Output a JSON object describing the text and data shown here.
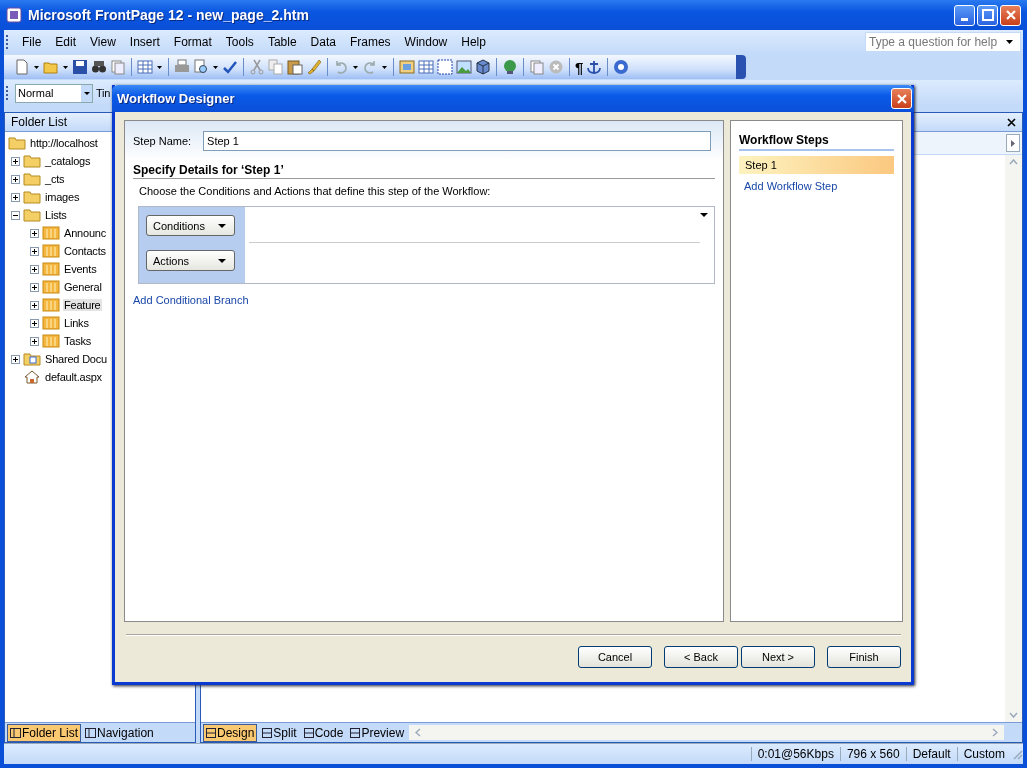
{
  "window": {
    "title": "Microsoft FrontPage 12  - new_page_2.htm"
  },
  "menu": [
    "File",
    "Edit",
    "View",
    "Insert",
    "Format",
    "Tools",
    "Table",
    "Data",
    "Frames",
    "Window",
    "Help"
  ],
  "help_box": {
    "placeholder": "Type a question for help"
  },
  "toolbar": {
    "pilcrow": "¶"
  },
  "format_bar": {
    "style": "Normal",
    "font": "Tin"
  },
  "folder_list": {
    "title": "Folder List",
    "tree": [
      {
        "label": "http://localhost",
        "kind": "site",
        "selected": false,
        "children": [
          {
            "label": "_catalogs",
            "kind": "folder",
            "expanded": false,
            "selected": false
          },
          {
            "label": "_cts",
            "kind": "folder",
            "expanded": false,
            "selected": false
          },
          {
            "label": "images",
            "kind": "folder",
            "expanded": false,
            "selected": false
          },
          {
            "label": "Lists",
            "kind": "folder",
            "expanded": true,
            "selected": false,
            "children": [
              {
                "label": "Announc",
                "kind": "list",
                "expanded": false,
                "selected": false
              },
              {
                "label": "Contacts",
                "kind": "list",
                "expanded": false,
                "selected": false
              },
              {
                "label": "Events",
                "kind": "list",
                "expanded": false,
                "selected": false
              },
              {
                "label": "General",
                "kind": "list",
                "expanded": false,
                "selected": false
              },
              {
                "label": "Feature",
                "kind": "list",
                "expanded": false,
                "selected": true
              },
              {
                "label": "Links",
                "kind": "list",
                "expanded": false,
                "selected": false
              },
              {
                "label": "Tasks",
                "kind": "list",
                "expanded": false,
                "selected": false
              }
            ]
          },
          {
            "label": "Shared Docu",
            "kind": "library",
            "expanded": false,
            "selected": false
          },
          {
            "label": "default.aspx",
            "kind": "home",
            "selected": false
          }
        ]
      }
    ]
  },
  "left_tabs": [
    {
      "label": "Folder List",
      "selected": true
    },
    {
      "label": "Navigation",
      "selected": false
    }
  ],
  "view_tabs": [
    {
      "label": "Design",
      "selected": true
    },
    {
      "label": "Split",
      "selected": false
    },
    {
      "label": "Code",
      "selected": false
    },
    {
      "label": "Preview",
      "selected": false
    }
  ],
  "status_bar": [
    "0:01@56Kbps",
    "796 x 560",
    "Default",
    "Custom"
  ],
  "dialog": {
    "title": "Workflow Designer",
    "step_name": {
      "label": "Step Name:",
      "value": "Step 1"
    },
    "section_title": "Specify Details for ‘Step 1’",
    "instructions": "Choose the Conditions and Actions that define this step of the Workflow:",
    "branch_buttons": [
      "Conditions",
      "Actions"
    ],
    "add_branch_link": "Add Conditional Branch",
    "steps_panel": {
      "title": "Workflow Steps",
      "steps": [
        {
          "label": "Step 1",
          "selected": true
        }
      ],
      "add_link": "Add Workflow Step"
    },
    "buttons": [
      "Cancel",
      "< Back",
      "Next >",
      "Finish"
    ]
  }
}
